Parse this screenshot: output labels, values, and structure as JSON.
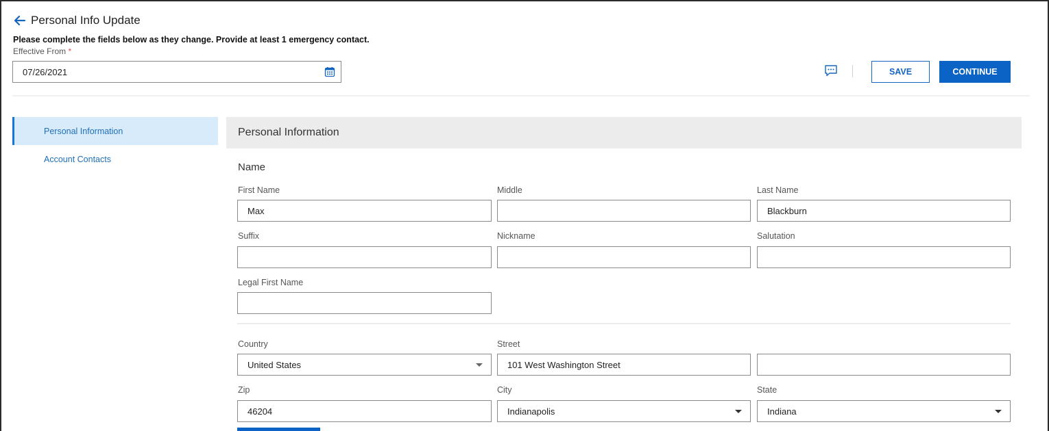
{
  "header": {
    "title": "Personal Info Update",
    "instructions": "Please complete the fields below as they change. Provide at least 1 emergency contact.",
    "effective_label": "Effective From",
    "required_mark": "*",
    "effective_value": "07/26/2021"
  },
  "actions": {
    "save_label": "SAVE",
    "continue_label": "CONTINUE"
  },
  "sidebar": {
    "items": [
      {
        "label": "Personal Information",
        "active": true
      },
      {
        "label": "Account Contacts",
        "active": false
      }
    ]
  },
  "section": {
    "title": "Personal Information",
    "name_heading": "Name"
  },
  "fields": {
    "first_name": {
      "label": "First Name",
      "value": "Max"
    },
    "middle": {
      "label": "Middle",
      "value": ""
    },
    "last_name": {
      "label": "Last Name",
      "value": "Blackburn"
    },
    "suffix": {
      "label": "Suffix",
      "value": ""
    },
    "nickname": {
      "label": "Nickname",
      "value": ""
    },
    "salutation": {
      "label": "Salutation",
      "value": ""
    },
    "legal_first_name": {
      "label": "Legal First Name",
      "value": ""
    },
    "country": {
      "label": "Country",
      "value": "United States"
    },
    "street": {
      "label": "Street",
      "value": "101 West Washington Street"
    },
    "street2": {
      "value": ""
    },
    "zip": {
      "label": "Zip",
      "value": "46204"
    },
    "city": {
      "label": "City",
      "value": "Indianapolis"
    },
    "state": {
      "label": "State",
      "value": "Indiana"
    }
  },
  "icons": {
    "back": "arrow-left-icon",
    "calendar": "calendar-icon",
    "comment": "comment-icon",
    "dropdown": "chevron-down-icon"
  },
  "colors": {
    "accent": "#0b63c5",
    "link": "#1f6fb8",
    "active_bg": "#d8ebfb",
    "section_bg": "#ececec",
    "required": "#d9534f"
  }
}
